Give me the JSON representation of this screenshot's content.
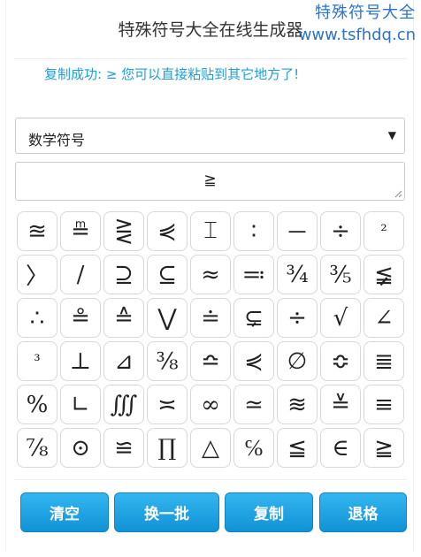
{
  "header": {
    "title": "特殊符号大全在线生成器"
  },
  "watermark": {
    "line1": "特殊符号大全",
    "line2": "www.tsfhdq.cn"
  },
  "status": {
    "message": "复制成功: ≥ 您可以直接粘贴到其它地方了!"
  },
  "category_select": {
    "selected": "数学符号",
    "caret": "▼"
  },
  "output": {
    "value": "≧"
  },
  "symbols": [
    "≊",
    "≞",
    "⋛",
    "⋞",
    "⌶",
    "∶",
    "－",
    "÷",
    "²",
    "〉",
    "∕",
    "⊇",
    "⊆",
    "≈",
    "≕",
    "¾",
    "⅗",
    "≨",
    "∴",
    "≗",
    "≙",
    "⋁",
    "≐",
    "⊊",
    "÷",
    "√",
    "∠",
    "³",
    "⊥",
    "⊿",
    "⅜",
    "≏",
    "⋞",
    "∅",
    "≎",
    "≣",
    "%",
    "∟",
    "∭",
    "≍",
    "∞",
    "≃",
    "≋",
    "≚",
    "≡",
    "⅞",
    "⊙",
    "≌",
    "∏",
    "△",
    "℅",
    "≦",
    "∈",
    "≧"
  ],
  "buttons": {
    "clear": "清空",
    "next_batch": "换一批",
    "copy": "复制",
    "backspace": "退格"
  }
}
